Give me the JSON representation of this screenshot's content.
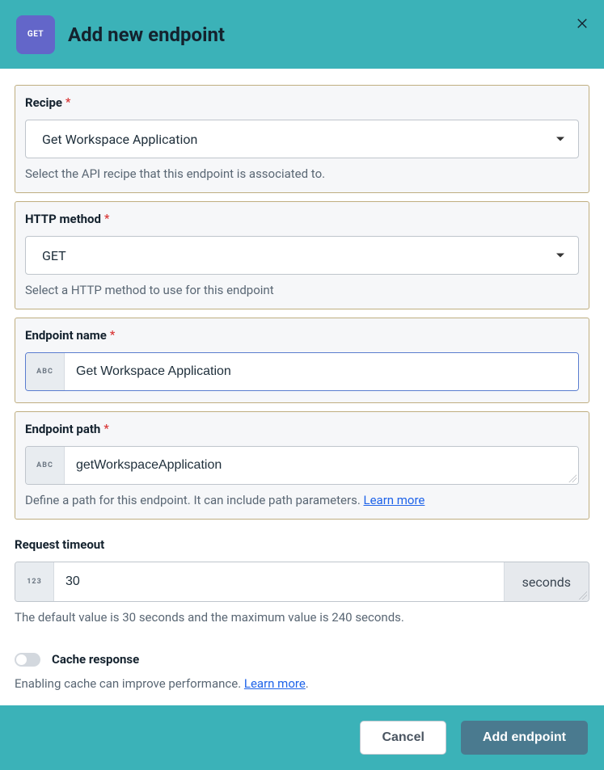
{
  "header": {
    "badge": "GET",
    "title": "Add new endpoint"
  },
  "fields": {
    "recipe": {
      "label": "Recipe",
      "value": "Get Workspace Application",
      "helper": "Select the API recipe that this endpoint is associated to."
    },
    "http_method": {
      "label": "HTTP method",
      "value": "GET",
      "helper": "Select a HTTP method to use for this endpoint"
    },
    "endpoint_name": {
      "label": "Endpoint name",
      "prefix": "ABC",
      "value": "Get Workspace Application"
    },
    "endpoint_path": {
      "label": "Endpoint path",
      "prefix": "ABC",
      "value": "getWorkspaceApplication",
      "helper_text": "Define a path for this endpoint. It can include path parameters. ",
      "helper_link": "Learn more"
    },
    "request_timeout": {
      "label": "Request timeout",
      "prefix": "123",
      "value": "30",
      "unit": "seconds",
      "helper": "The default value is 30 seconds and the maximum value is 240 seconds."
    },
    "cache_response": {
      "label": "Cache response",
      "helper_text": "Enabling cache can improve performance. ",
      "helper_link": "Learn more",
      "helper_suffix": "."
    }
  },
  "footer": {
    "cancel": "Cancel",
    "submit": "Add endpoint"
  }
}
